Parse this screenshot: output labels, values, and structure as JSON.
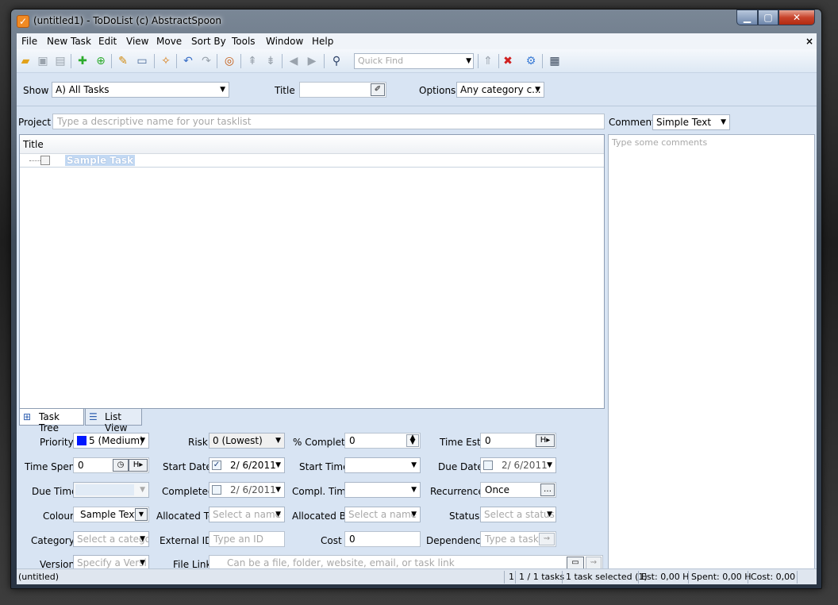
{
  "window": {
    "title": "(untitled1) - ToDoList (c) AbstractSpoon",
    "icon": "check-icon"
  },
  "menu": [
    "File",
    "New Task",
    "Edit",
    "View",
    "Move",
    "Sort By",
    "Tools",
    "Window",
    "Help"
  ],
  "toolbar": {
    "quick_find_placeholder": "Quick Find",
    "icons": [
      "open-folder-icon",
      "save-icon",
      "save-all-icon",
      "add-task-icon",
      "add-subtask-icon",
      "edit-icon",
      "properties-icon",
      "cleanup-icon",
      "undo-icon",
      "redo-icon",
      "center-icon",
      "move-up-icon",
      "move-down-icon",
      "back-icon",
      "forward-icon",
      "find-icon",
      "goto-parent-icon",
      "delete-icon",
      "preferences-icon",
      "calendar-icon"
    ]
  },
  "filter": {
    "show_label": "Show",
    "show_value": "A)   All Tasks",
    "title_label": "Title",
    "title_value": "",
    "options_label": "Options",
    "options_value": "Any category c..."
  },
  "project": {
    "label": "Project",
    "placeholder": "Type a descriptive name for your tasklist"
  },
  "comments": {
    "label": "Comments",
    "type_value": "Simple Text",
    "placeholder": "Type some comments"
  },
  "tasklist": {
    "column_title": "Title",
    "tasks": [
      {
        "title": "Sample Task"
      }
    ]
  },
  "tabs": [
    {
      "label": "Task Tree",
      "icon": "tree-icon"
    },
    {
      "label": "List View",
      "icon": "list-icon"
    }
  ],
  "fields": {
    "priority_label": "Priority",
    "priority_value": "5 (Medium)",
    "priority_color": "#0018ff",
    "risk_label": "Risk",
    "risk_value": "0 (Lowest)",
    "percent_label": "% Complete",
    "percent_value": "0",
    "time_est_label": "Time Est.",
    "time_est_value": "0",
    "time_est_unit": "H",
    "time_spent_label": "Time Spent",
    "time_spent_value": "0",
    "time_spent_unit": "H",
    "start_date_label": "Start Date",
    "start_date_value": "2/  6/2011",
    "start_time_label": "Start Time",
    "start_time_value": "",
    "due_date_label": "Due Date",
    "due_date_value": "2/  6/2011",
    "due_time_label": "Due Time",
    "completed_label": "Completed",
    "completed_value": "2/  6/2011",
    "compl_time_label": "Compl. Time",
    "compl_time_value": "",
    "recurrence_label": "Recurrence",
    "recurrence_value": "Once",
    "colour_label": "Colour",
    "colour_value": "Sample Text",
    "allocated_to_label": "Allocated To",
    "allocated_to_placeholder": "Select a name",
    "allocated_by_label": "Allocated By",
    "allocated_by_placeholder": "Select a name",
    "status_label": "Status",
    "status_placeholder": "Select a status",
    "category_label": "Category",
    "category_placeholder": "Select a catego",
    "external_id_label": "External ID",
    "external_id_placeholder": "Type an ID",
    "cost_label": "Cost",
    "cost_value": "0",
    "dependency_label": "Dependency",
    "dependency_placeholder": "Type a task ID",
    "version_label": "Version",
    "version_placeholder": "Specify a Versi",
    "file_link_label": "File Link",
    "file_link_placeholder": "Can be a file, folder, website, email, or task link"
  },
  "status": {
    "file": "(untitled)",
    "count": "1",
    "tasks": "1 / 1 tasks",
    "selected": "1 task selected (1)",
    "est": "Est: 0,00 H",
    "spent": "Spent: 0,00 H",
    "cost": "Cost: 0,00"
  }
}
